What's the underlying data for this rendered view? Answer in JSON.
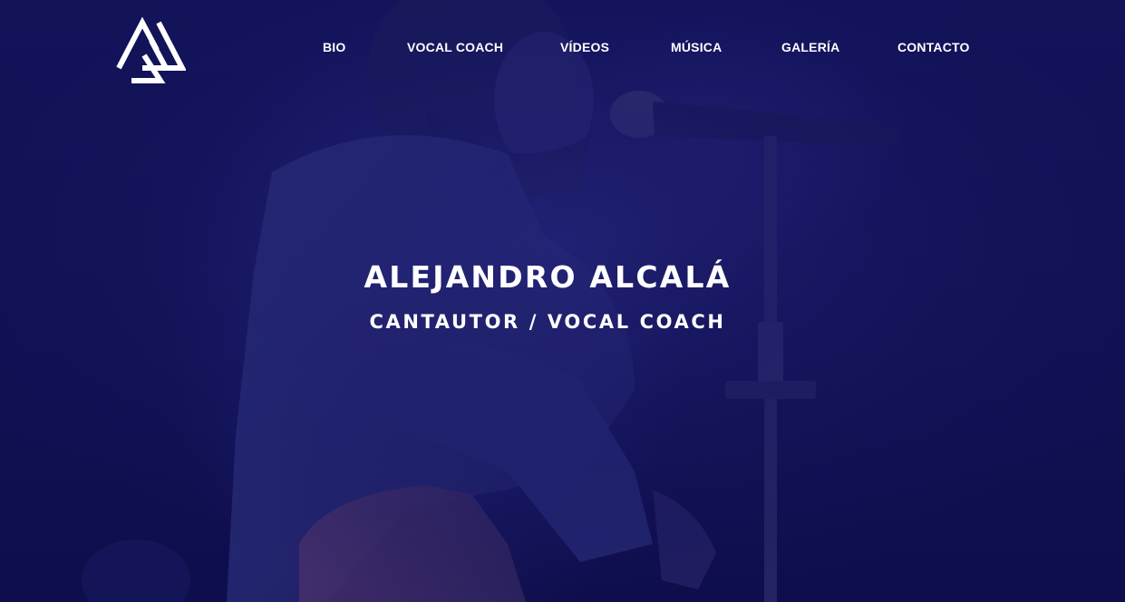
{
  "nav": {
    "items": [
      {
        "label": "BIO"
      },
      {
        "label": "VOCAL COACH"
      },
      {
        "label": "VÍDEOS"
      },
      {
        "label": "MÚSICA"
      },
      {
        "label": "GALERÍA"
      },
      {
        "label": "CONTACTO"
      }
    ]
  },
  "hero": {
    "title": "ALEJANDRO ALCALÁ",
    "subtitle": "CANTAUTOR / VOCAL COACH"
  },
  "logo": {
    "icon": "triangle-monogram-logo"
  },
  "colors": {
    "overlay": "#16146e",
    "background": "#0f0f4a",
    "text": "#ffffff"
  }
}
